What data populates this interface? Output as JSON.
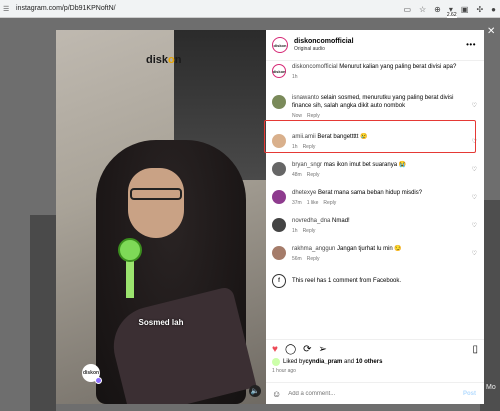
{
  "browser": {
    "url": "instagram.com/p/Db91KPNoftN/",
    "extension_version": "2.62"
  },
  "post": {
    "username": "diskoncomofficial",
    "audio": "Original audio",
    "avatar_text": "diskon"
  },
  "video": {
    "logo_prefix": "disk",
    "logo_accent": "o",
    "logo_suffix": "n",
    "caption": "Sosmed lah",
    "avatar_text": "diskon"
  },
  "comments": [
    {
      "user": "diskoncomofficial",
      "text": "Menurut kalian yang paling berat divisi apa?",
      "time": "1h",
      "likes": "",
      "reply": "",
      "avatar_color": "#ffffff"
    },
    {
      "user": "isnawanto",
      "text": "selain sosmed, menurutku yang paling berat divisi finance sih, salah angka dikit auto nombok",
      "time": "Now",
      "likes": "",
      "reply": "Reply",
      "avatar_color": "#7a8a5a"
    },
    {
      "user": "amii.amii",
      "text": "Berat bangettttt 😢",
      "time": "1h",
      "likes": "",
      "reply": "Reply",
      "avatar_color": "#d9b08c"
    },
    {
      "user": "bryan_sngr",
      "text": "mas ikon imut bet suaranya 😭",
      "time": "48m",
      "likes": "",
      "reply": "Reply",
      "avatar_color": "#666666"
    },
    {
      "user": "dhetexye",
      "text": "Berat mana sama beban hidup misdis?",
      "time": "37m",
      "likes": "1 like",
      "reply": "Reply",
      "avatar_color": "#8e3b8e"
    },
    {
      "user": "novredha_dna",
      "text": "Nmad!",
      "time": "1h",
      "likes": "",
      "reply": "Reply",
      "avatar_color": "#444444"
    },
    {
      "user": "rakhma_anggun",
      "text": "Jangan tjurhat lu min 😏",
      "time": "56m",
      "likes": "",
      "reply": "Reply",
      "avatar_color": "#a57c6a"
    }
  ],
  "facebook_note": "This reel has 1 comment from Facebook.",
  "likes": {
    "prefix": "Liked by ",
    "user": "cyndia_pram",
    "connector": " and ",
    "others": "10 others"
  },
  "posted_ago": "1 hour ago",
  "add_comment": {
    "placeholder": "Add a comment...",
    "post_label": "Post"
  },
  "backdrop_more": "Mo"
}
